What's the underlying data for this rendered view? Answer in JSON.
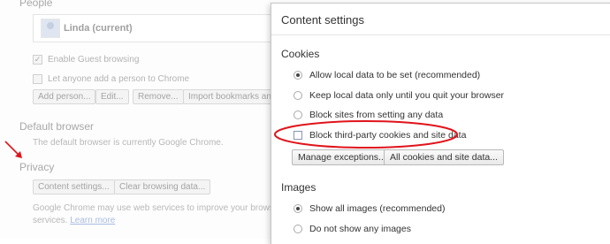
{
  "background": {
    "people_heading": "People",
    "profile_name": "Linda (current)",
    "enable_guest_label": "Enable Guest browsing",
    "let_anyone_label": "Let anyone add a person to Chrome",
    "people_buttons": [
      "Add person...",
      "Edit...",
      "Remove...",
      "Import bookmarks and"
    ],
    "default_browser_heading": "Default browser",
    "default_browser_text": "The default browser is currently Google Chrome.",
    "privacy_heading": "Privacy",
    "content_settings_button": "Content settings...",
    "clear_browsing_button": "Clear browsing data...",
    "privacy_text": "Google Chrome may use web services to improve your browsing exp",
    "privacy_text2": "services.",
    "learn_more": "Learn more"
  },
  "dialog": {
    "title": "Content settings",
    "cookies": {
      "heading": "Cookies",
      "options": [
        {
          "label": "Allow local data to be set (recommended)",
          "selected": true
        },
        {
          "label": "Keep local data only until you quit your browser",
          "selected": false
        },
        {
          "label": "Block sites from setting any data",
          "selected": false
        }
      ],
      "block_third_party_label": "Block third-party cookies and site data",
      "block_third_party_checked": false,
      "manage_exceptions_button": "Manage exceptions...",
      "all_cookies_button": "All cookies and site data..."
    },
    "images": {
      "heading": "Images",
      "options": [
        {
          "label": "Show all images (recommended)",
          "selected": true
        },
        {
          "label": "Do not show any images",
          "selected": false
        }
      ]
    }
  },
  "annotation_color": "#e0141b"
}
